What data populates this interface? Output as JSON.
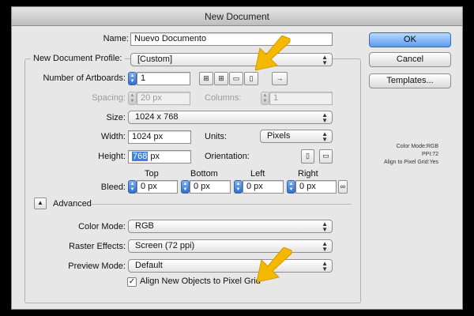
{
  "dialog": {
    "title": "New Document",
    "name": {
      "label": "Name:",
      "value": "Nuevo Documento"
    },
    "profile": {
      "label": "New Document Profile:",
      "value": "[Custom]"
    },
    "artboards": {
      "label": "Number of Artboards:",
      "value": "1",
      "arrange_icons": [
        "grid-by-row-icon",
        "grid-by-column-icon",
        "arrange-by-row-icon",
        "arrange-by-column-icon",
        "right-to-left-layout-icon"
      ]
    },
    "spacing": {
      "label": "Spacing:",
      "value": "20 px"
    },
    "columns": {
      "label": "Columns:",
      "value": "1"
    },
    "size": {
      "label": "Size:",
      "value": "1024 x 768"
    },
    "width": {
      "label": "Width:",
      "value": "1024 px"
    },
    "units": {
      "label": "Units:",
      "value": "Pixels"
    },
    "height": {
      "label": "Height:",
      "value_selected": "768",
      "value_rest": " px"
    },
    "orientation": {
      "label": "Orientation:",
      "icons": [
        "portrait-icon",
        "landscape-icon"
      ]
    },
    "bleed": {
      "label": "Bleed:",
      "headers": [
        "Top",
        "Bottom",
        "Left",
        "Right"
      ],
      "values": [
        "0 px",
        "0 px",
        "0 px",
        "0 px"
      ]
    },
    "advanced": {
      "label": "Advanced",
      "toggle_glyph": "▲"
    },
    "color_mode": {
      "label": "Color Mode:",
      "value": "RGB"
    },
    "raster_effects": {
      "label": "Raster Effects:",
      "value": "Screen (72 ppi)"
    },
    "preview_mode": {
      "label": "Preview Mode:",
      "value": "Default"
    },
    "align_pixel_grid": {
      "label": "Align New Objects to Pixel Grid",
      "checked": true,
      "glyph": "✓"
    },
    "buttons": {
      "ok": "OK",
      "cancel": "Cancel",
      "templates": "Templates..."
    },
    "summary": {
      "color_mode": "Color Mode:RGB",
      "ppi": "PPI:72",
      "align": "Align to Pixel Grid:Yes"
    }
  },
  "colors": {
    "arrow": "#f5b800",
    "default_button": "#5f9cec"
  }
}
